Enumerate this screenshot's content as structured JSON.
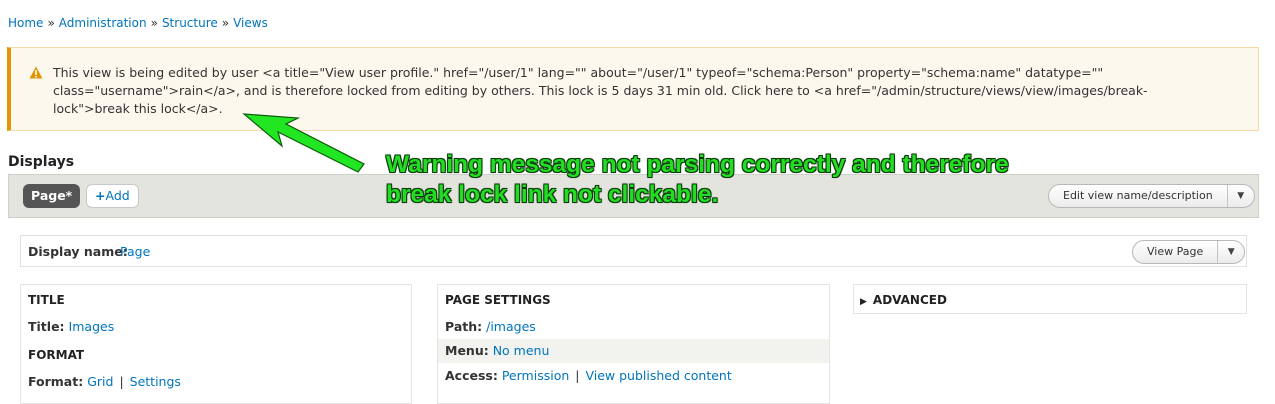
{
  "breadcrumb": [
    "Home",
    "Administration",
    "Structure",
    "Views"
  ],
  "breadcrumb_separator": "»",
  "warning": {
    "icon": "warning-triangle-icon",
    "text": "This view is being edited by user <a title=\"View user profile.\" href=\"/user/1\" lang=\"\" about=\"/user/1\" typeof=\"schema:Person\" property=\"schema:name\" datatype=\"\" class=\"username\">rain</a>, and is therefore locked from editing by others. This lock is 5 days 31 min old. Click here to <a href=\"/admin/structure/views/view/images/break-lock\">break this lock</a>."
  },
  "displays": {
    "title": "Displays",
    "active_tab": "Page*",
    "add_label": "Add",
    "edit_name_button": "Edit view name/description"
  },
  "display_name": {
    "label": "Display name:",
    "value": "Page",
    "view_button": "View Page"
  },
  "columns": {
    "left": {
      "title_header": "TITLE",
      "title_label": "Title:",
      "title_value": "Images",
      "format_header": "FORMAT",
      "format_label": "Format:",
      "format_value": "Grid",
      "format_settings": "Settings"
    },
    "middle": {
      "header": "PAGE SETTINGS",
      "path_label": "Path:",
      "path_value": "/images",
      "menu_label": "Menu:",
      "menu_value": "No menu",
      "access_label": "Access:",
      "access_value": "Permission",
      "access_link": "View published content"
    },
    "right": {
      "header": "ADVANCED"
    }
  },
  "annotation": "Warning message not parsing correctly and therefore break lock link not clickable.",
  "colors": {
    "link": "#0074bd",
    "warning_border": "#e09600",
    "warning_bg": "#fdf8ed",
    "annotation_text": "#22dd22",
    "tab_active_bg": "#555555"
  }
}
